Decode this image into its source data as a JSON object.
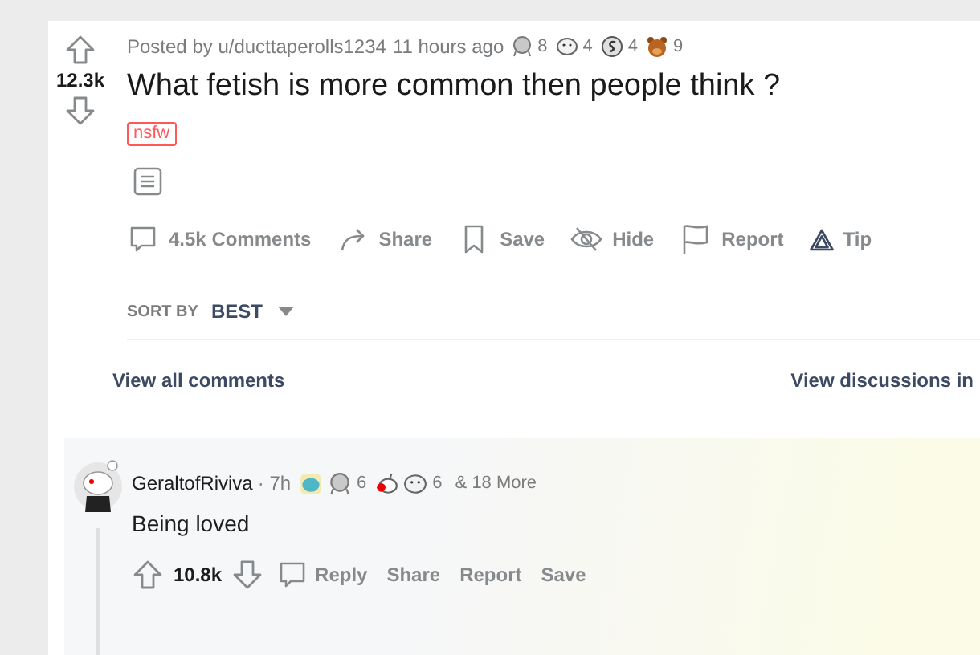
{
  "post": {
    "score": "12.3k",
    "upvoted": false,
    "posted_by": "Posted by u/ducttaperolls1234",
    "time": "11 hours ago",
    "awards": [
      {
        "kind": "medal",
        "count": "8"
      },
      {
        "kind": "face",
        "count": "4"
      },
      {
        "kind": "coin",
        "count": "4"
      },
      {
        "kind": "bear",
        "count": "9"
      }
    ],
    "title": "What fetish is more common then people think ?",
    "flair": "nsfw",
    "actions": [
      {
        "kind": "comment",
        "label": "4.5k Comments"
      },
      {
        "kind": "share",
        "label": "Share"
      },
      {
        "kind": "save",
        "label": "Save"
      },
      {
        "kind": "hide",
        "label": "Hide"
      },
      {
        "kind": "report",
        "label": "Report"
      },
      {
        "kind": "tip",
        "label": "Tip"
      }
    ]
  },
  "sort": {
    "label": "SORT BY",
    "value": "BEST"
  },
  "links": {
    "left": "View all comments",
    "right": "View discussions in"
  },
  "comment": {
    "author": "GeraltofRiviva",
    "time": "· 7h",
    "awards": [
      {
        "kind": "drop"
      },
      {
        "kind": "medal",
        "count": "6"
      },
      {
        "kind": "bird"
      },
      {
        "kind": "face",
        "count": "6"
      }
    ],
    "more": "& 18 More",
    "body": "Being loved",
    "score": "10.8k",
    "actions": [
      {
        "kind": "reply",
        "label": "Reply"
      },
      {
        "kind": "text",
        "label": "Share"
      },
      {
        "kind": "text",
        "label": "Report"
      },
      {
        "kind": "text",
        "label": "Save"
      }
    ]
  }
}
